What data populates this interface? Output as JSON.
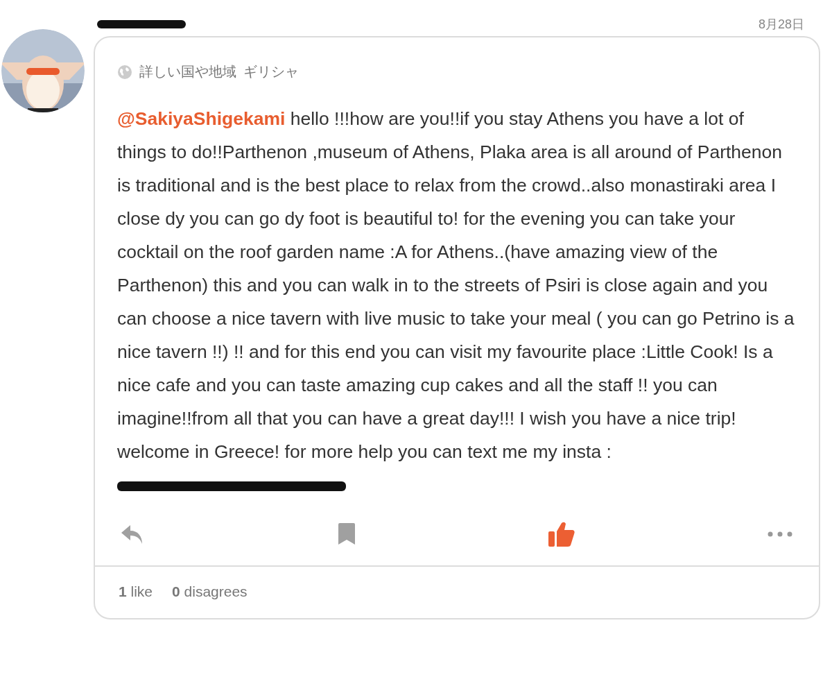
{
  "post": {
    "date": "8月28日",
    "region_label": "詳しい国や地域",
    "region": "ギリシャ",
    "body": "**@SakiyaShigekami** hello !!!how are you!!if you stay Athens you have a lot of things to do!!Parthenon ,museum of Athens, Plaka area is all around of Parthenon is traditional and is the best place to relax from the crowd..also monastiraki area I close dy you can go dy foot is beautiful to! for the evening you can take your cocktail on the roof garden name :A for Athens..(have amazing view of the Parthenon) this and you can walk in to the streets of Psiri is close again and you can choose a nice tavern with live music to take your meal ( you can go Petrino is a nice tavern !!) !! and for this end you can visit my favourite place :Little Cook! Is a nice cafe and you can taste amazing cup cakes and all the staff !! you can imagine!!from all that you can have a great day!!! I wish you have a nice trip! welcome in Greece! for more help you can text me my insta :",
    "liked": true,
    "stats": [
      "**1** like",
      "**0** disagrees"
    ]
  }
}
